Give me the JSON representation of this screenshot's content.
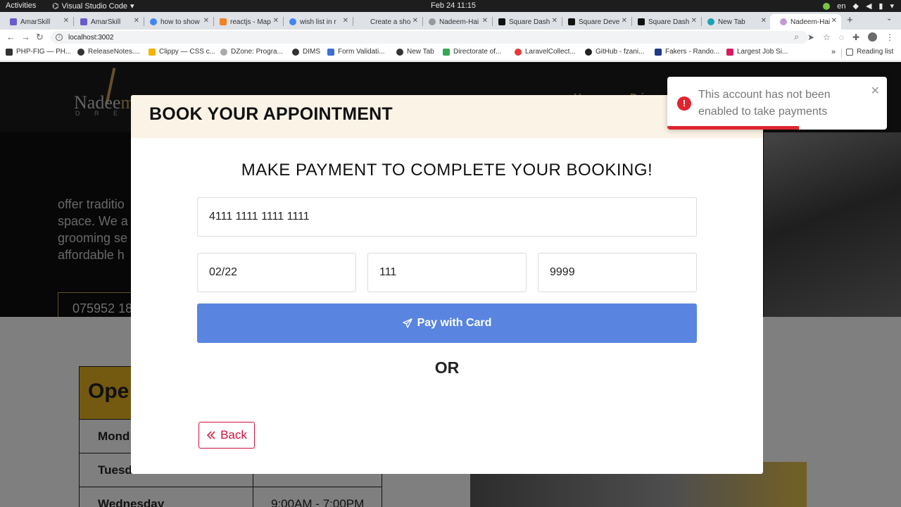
{
  "system_bar": {
    "activities": "Activities",
    "app_name": "Visual Studio Code",
    "clock": "Feb 24  11:15",
    "lang": "en"
  },
  "tabs": [
    {
      "title": "AmarSkill"
    },
    {
      "title": "AmarSkill"
    },
    {
      "title": "how to show"
    },
    {
      "title": "reactjs - Map"
    },
    {
      "title": "wish list in r"
    },
    {
      "title": "Create a sho"
    },
    {
      "title": "Nadeem-Hai"
    },
    {
      "title": "Square Dash"
    },
    {
      "title": "Square Deve"
    },
    {
      "title": "Square Dash"
    },
    {
      "title": "New Tab"
    },
    {
      "title": "Nadeem-Hai"
    }
  ],
  "address_bar": {
    "url": "localhost:3002"
  },
  "bookmarks": [
    {
      "title": "PHP-FIG — PH..."
    },
    {
      "title": "ReleaseNotes...."
    },
    {
      "title": "Clippy — CSS c..."
    },
    {
      "title": "DZone: Progra..."
    },
    {
      "title": "DIMS"
    },
    {
      "title": "Form Validati..."
    },
    {
      "title": "New Tab"
    },
    {
      "title": "Directorate of..."
    },
    {
      "title": "LaravelCollect..."
    },
    {
      "title": "GitHub - fzani..."
    },
    {
      "title": "Fakers - Rando..."
    },
    {
      "title": "Largest Job Si..."
    }
  ],
  "bookmarks_more": "»",
  "reading_list": "Reading list",
  "site": {
    "logo_part1": "Nadee",
    "logo_part2": "m",
    "logo_sub": "D R E S",
    "nav": [
      "Home",
      "Pric"
    ],
    "hero_lines": [
      "offer traditio",
      "space. We a",
      "grooming se",
      "affordable h"
    ],
    "phone": "075952 18",
    "hours_title": "Ope",
    "hours_rows": [
      {
        "day": "Mond",
        "time": ""
      },
      {
        "day": "Tuesd",
        "time": ""
      },
      {
        "day": "Wednesday",
        "time": "9:00AM - 7:00PM"
      }
    ]
  },
  "modal": {
    "title": "BOOK YOUR APPOINTMENT",
    "heading": "MAKE PAYMENT TO COMPLETE YOUR BOOKING!",
    "card_number": "4111 1111 1111 1111",
    "expiry": "02/22",
    "cvv": "111",
    "postal": "9999",
    "pay_label": "Pay with Card",
    "or_label": "OR",
    "back_label": "Back"
  },
  "toast": {
    "message": "This account has not been enabled to take payments",
    "progress": 0.6,
    "color": "#e0242f"
  },
  "colors": {
    "pay_button": "#5985e1",
    "back_button": "#d0103a",
    "modal_header": "#fcf3e7",
    "gold": "#c8a05a"
  }
}
